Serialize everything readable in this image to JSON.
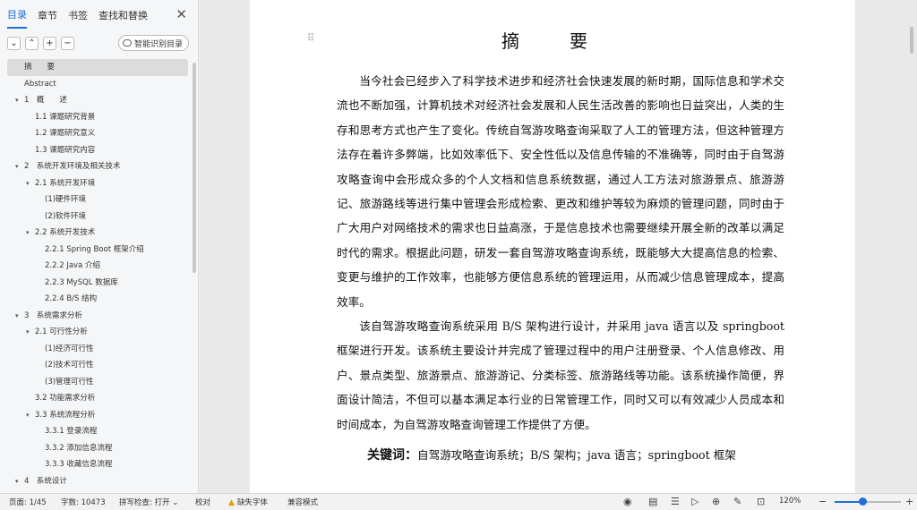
{
  "sidebar": {
    "tabs": [
      "目录",
      "章节",
      "书签",
      "查找和替换"
    ],
    "active_tab": 0,
    "toolbar": {
      "collapse": "⌄",
      "expand": "⌃",
      "add": "+",
      "remove": "−",
      "smart_button": "智能识别目录"
    }
  },
  "toc": [
    {
      "label": "摘　　要",
      "level": 0,
      "active": true
    },
    {
      "label": "Abstract",
      "level": 0
    },
    {
      "label": "1　概　　述",
      "level": 0,
      "expanded": true
    },
    {
      "label": "1.1  课题研究背景",
      "level": 1
    },
    {
      "label": "1.2  课题研究意义",
      "level": 1
    },
    {
      "label": "1.3  课题研究内容",
      "level": 1
    },
    {
      "label": "2　系统开发环境及相关技术",
      "level": 0,
      "expanded": true
    },
    {
      "label": "2.1  系统开发环境",
      "level": 1,
      "expanded": true
    },
    {
      "label": "(1)硬件环境",
      "level": 2
    },
    {
      "label": "(2)软件环境",
      "level": 2
    },
    {
      "label": "2.2  系统开发技术",
      "level": 1,
      "expanded": true
    },
    {
      "label": "2.2.1 Spring Boot 框架介绍",
      "level": 2
    },
    {
      "label": "2.2.2 Java 介绍",
      "level": 2
    },
    {
      "label": "2.2.3 MySQL 数据库",
      "level": 2
    },
    {
      "label": "2.2.4 B/S 结构",
      "level": 2
    },
    {
      "label": "3　系统需求分析",
      "level": 0,
      "expanded": true
    },
    {
      "label": "2.1  可行性分析",
      "level": 1,
      "expanded": true
    },
    {
      "label": "(1)经济可行性",
      "level": 2
    },
    {
      "label": "(2)技术可行性",
      "level": 2
    },
    {
      "label": "(3)管理可行性",
      "level": 2
    },
    {
      "label": "3.2  功能需求分析",
      "level": 1
    },
    {
      "label": "3.3  系统流程分析",
      "level": 1,
      "expanded": true
    },
    {
      "label": "3.3.1  登录流程",
      "level": 2
    },
    {
      "label": "3.3.2  添加信息流程",
      "level": 2
    },
    {
      "label": "3.3.3  收藏信息流程",
      "level": 2
    },
    {
      "label": "4　系统设计",
      "level": 0,
      "expanded": true
    }
  ],
  "document": {
    "title": "摘　要",
    "paragraphs": [
      "当今社会已经步入了科学技术进步和经济社会快速发展的新时期，国际信息和学术交流也不断加强，计算机技术对经济社会发展和人民生活改善的影响也日益突出，人类的生存和思考方式也产生了变化。传统自驾游攻略查询采取了人工的管理方法，但这种管理方法存在着许多弊端，比如效率低下、安全性低以及信息传输的不准确等，同时由于自驾游攻略查询中会形成众多的个人文档和信息系统数据，通过人工方法对旅游景点、旅游游记、旅游路线等进行集中管理会形成检索、更改和维护等较为麻烦的管理问题，同时由于广大用户对网络技术的需求也日益高涨，于是信息技术也需要继续开展全新的改革以满足时代的需求。根据此问题，研发一套自驾游攻略查询系统，既能够大大提高信息的检索、变更与维护的工作效率，也能够方便信息系统的管理运用，从而减少信息管理成本，提高效率。",
      "该自驾游攻略查询系统采用 B/S 架构进行设计，并采用 java 语言以及 springboot 框架进行开发。该系统主要设计并完成了管理过程中的用户注册登录、个人信息修改、用户、景点类型、旅游景点、旅游游记、分类标签、旅游路线等功能。该系统操作简便，界面设计简洁，不但可以基本满足本行业的日常管理工作，同时又可以有效减少人员成本和时间成本，为自驾游攻略查询管理工作提供了方便。"
    ],
    "keywords_label": "关键词：",
    "keywords": "自驾游攻略查询系统；B/S  架构；java 语言；springboot 框架"
  },
  "statusbar": {
    "page": "页面: 1/45",
    "words": "字数: 10473",
    "spellcheck": "拼写检查: 打开 ⌄",
    "proofread": "校对",
    "missing_font": "缺失字体",
    "compat": "兼容模式",
    "zoom": "120%",
    "zoom_level_fraction": 0.42
  }
}
